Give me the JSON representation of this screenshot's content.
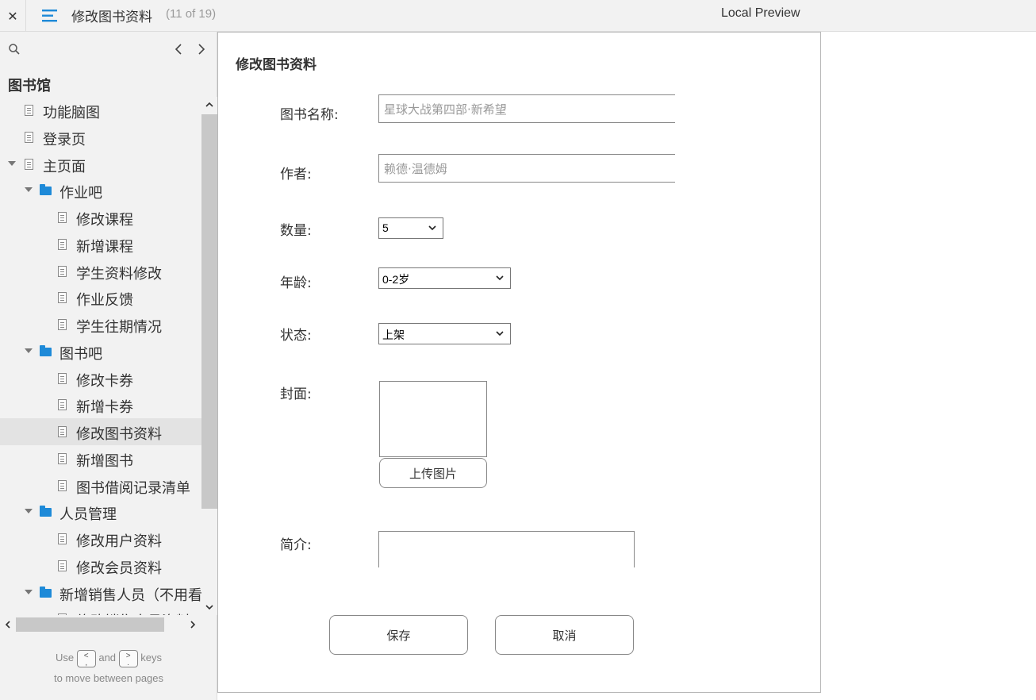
{
  "topbar": {
    "close_glyph": "✕",
    "title": "修改图书资料",
    "count": "(11 of 19)",
    "preview": "Local Preview"
  },
  "sidebar": {
    "root": "图书馆",
    "items": [
      {
        "label": "功能脑图",
        "type": "page",
        "level": 1
      },
      {
        "label": "登录页",
        "type": "page",
        "level": 1
      },
      {
        "label": "主页面",
        "type": "page",
        "level": 1,
        "expanded": true
      },
      {
        "label": "作业吧",
        "type": "folder",
        "level": 2,
        "expanded": true
      },
      {
        "label": "修改课程",
        "type": "page",
        "level": 3
      },
      {
        "label": "新增课程",
        "type": "page",
        "level": 3
      },
      {
        "label": "学生资料修改",
        "type": "page",
        "level": 3
      },
      {
        "label": "作业反馈",
        "type": "page",
        "level": 3
      },
      {
        "label": "学生往期情况",
        "type": "page",
        "level": 3
      },
      {
        "label": "图书吧",
        "type": "folder",
        "level": 2,
        "expanded": true
      },
      {
        "label": "修改卡券",
        "type": "page",
        "level": 3
      },
      {
        "label": "新增卡券",
        "type": "page",
        "level": 3
      },
      {
        "label": "修改图书资料",
        "type": "page",
        "level": 3,
        "selected": true
      },
      {
        "label": "新增图书",
        "type": "page",
        "level": 3
      },
      {
        "label": "图书借阅记录清单",
        "type": "page",
        "level": 3
      },
      {
        "label": "人员管理",
        "type": "folder",
        "level": 2,
        "expanded": true
      },
      {
        "label": "修改用户资料",
        "type": "page",
        "level": 3
      },
      {
        "label": "修改会员资料",
        "type": "page",
        "level": 3
      },
      {
        "label": "新增销售人员（不用看）",
        "type": "folder",
        "level": 2,
        "expanded": true
      },
      {
        "label": "修改销售人员资料",
        "type": "page",
        "level": 3
      }
    ],
    "hint": {
      "use": "Use",
      "key_prev": "<\n,",
      "and": "and",
      "key_next": ">\n.",
      "keys": "keys",
      "line2": "to move between pages"
    }
  },
  "form": {
    "title": "修改图书资料",
    "name_label": "图书名称:",
    "name_placeholder": "星球大战第四部·新希望",
    "author_label": "作者:",
    "author_placeholder": "赖德·温德姆",
    "qty_label": "数量:",
    "qty_value": "5",
    "age_label": "年龄:",
    "age_value": "0-2岁",
    "status_label": "状态:",
    "status_value": "上架",
    "cover_label": "封面:",
    "upload_label": "上传图片",
    "intro_label": "简介:",
    "save_label": "保存",
    "cancel_label": "取消"
  }
}
